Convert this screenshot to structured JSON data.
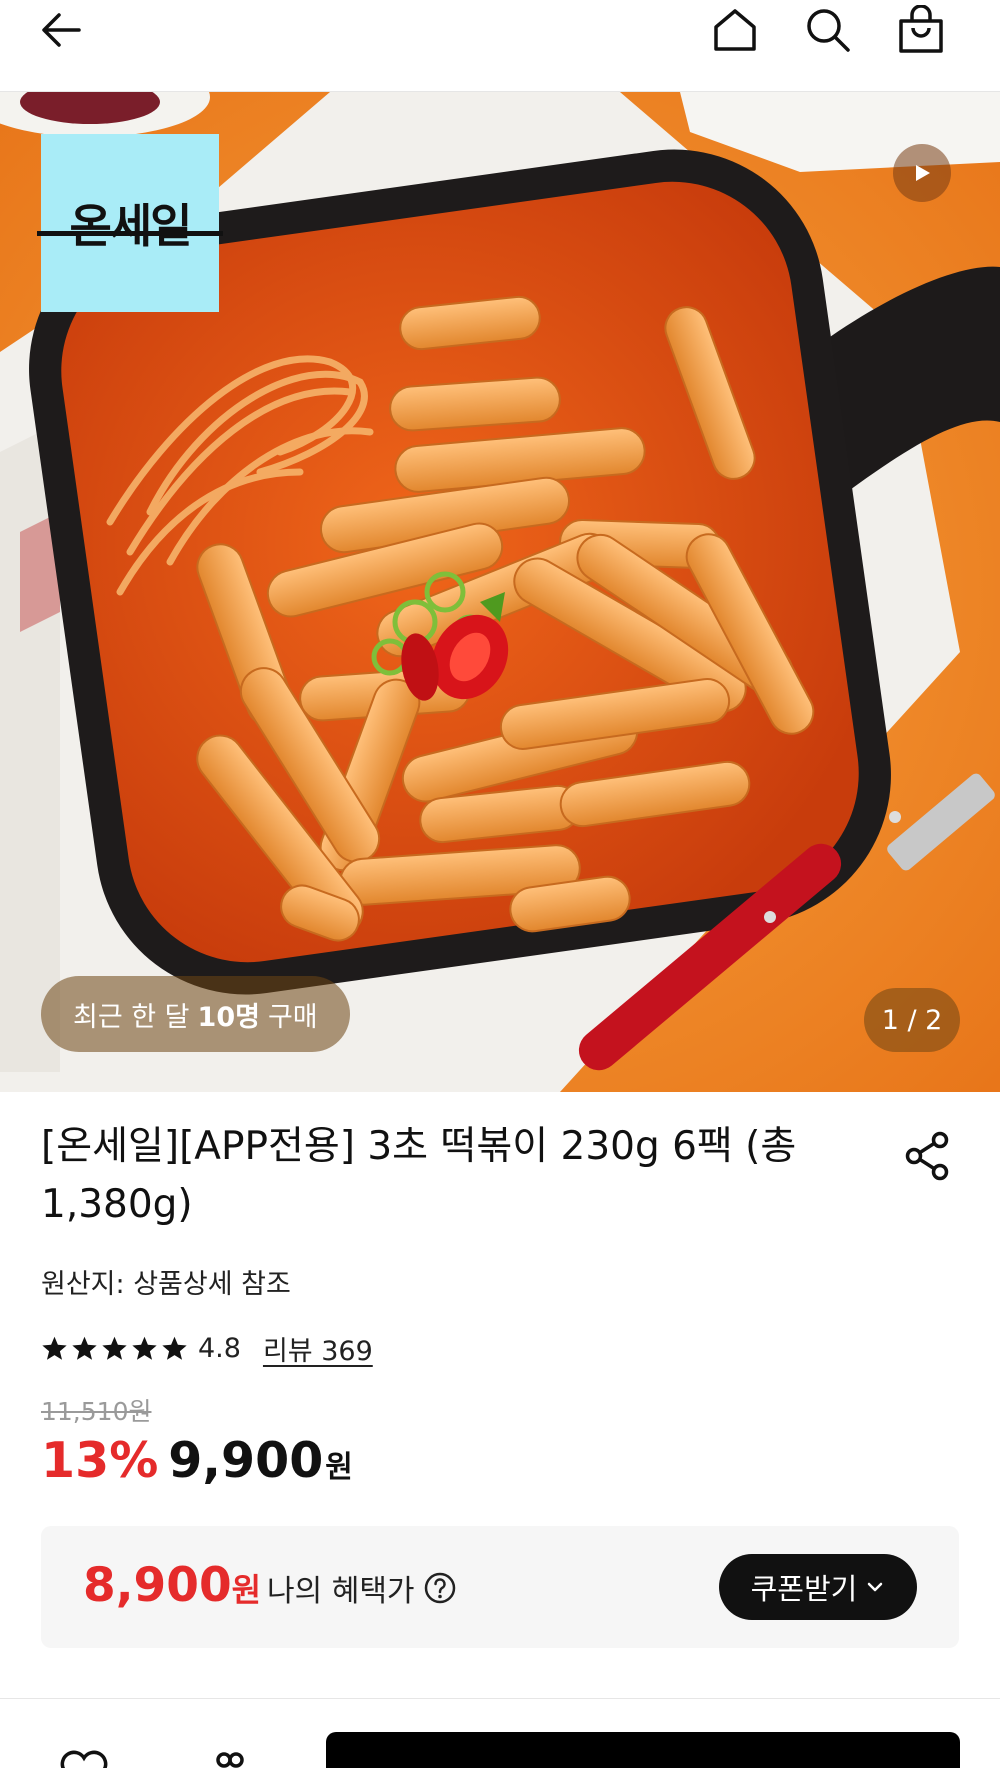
{
  "header": {
    "back_icon": "arrow-left-icon",
    "home_icon": "home-icon",
    "search_icon": "search-icon",
    "cart_icon": "shopping-bag-icon"
  },
  "hero": {
    "brand_logo_text": "온세일",
    "recent_purchase": {
      "prefix": "최근 한 달",
      "count": "10명",
      "suffix": "구매"
    },
    "pager": "1 / 2",
    "video_icon": "play-icon",
    "colors": {
      "background": "#f08a1c",
      "logo_bg": "#a9ecf7"
    }
  },
  "product": {
    "title": "[온세일][APP전용] 3초 떡볶이 230g 6팩 (총 1,380g)",
    "origin": "원산지: 상품상세 참조",
    "rating": "4.8",
    "stars": 5,
    "review_link": "리뷰 369",
    "original_price": "11,510원",
    "discount_rate": "13%",
    "sale_price": "9,900",
    "sale_unit": "원",
    "share_icon": "share-icon"
  },
  "benefit": {
    "price": "8,900",
    "unit": "원",
    "label": "나의 혜택가",
    "help_icon": "question-circle-icon",
    "coupon_button": "쿠폰받기"
  },
  "colors": {
    "discount_red": "#e52b2b",
    "text_dark": "#111111"
  }
}
